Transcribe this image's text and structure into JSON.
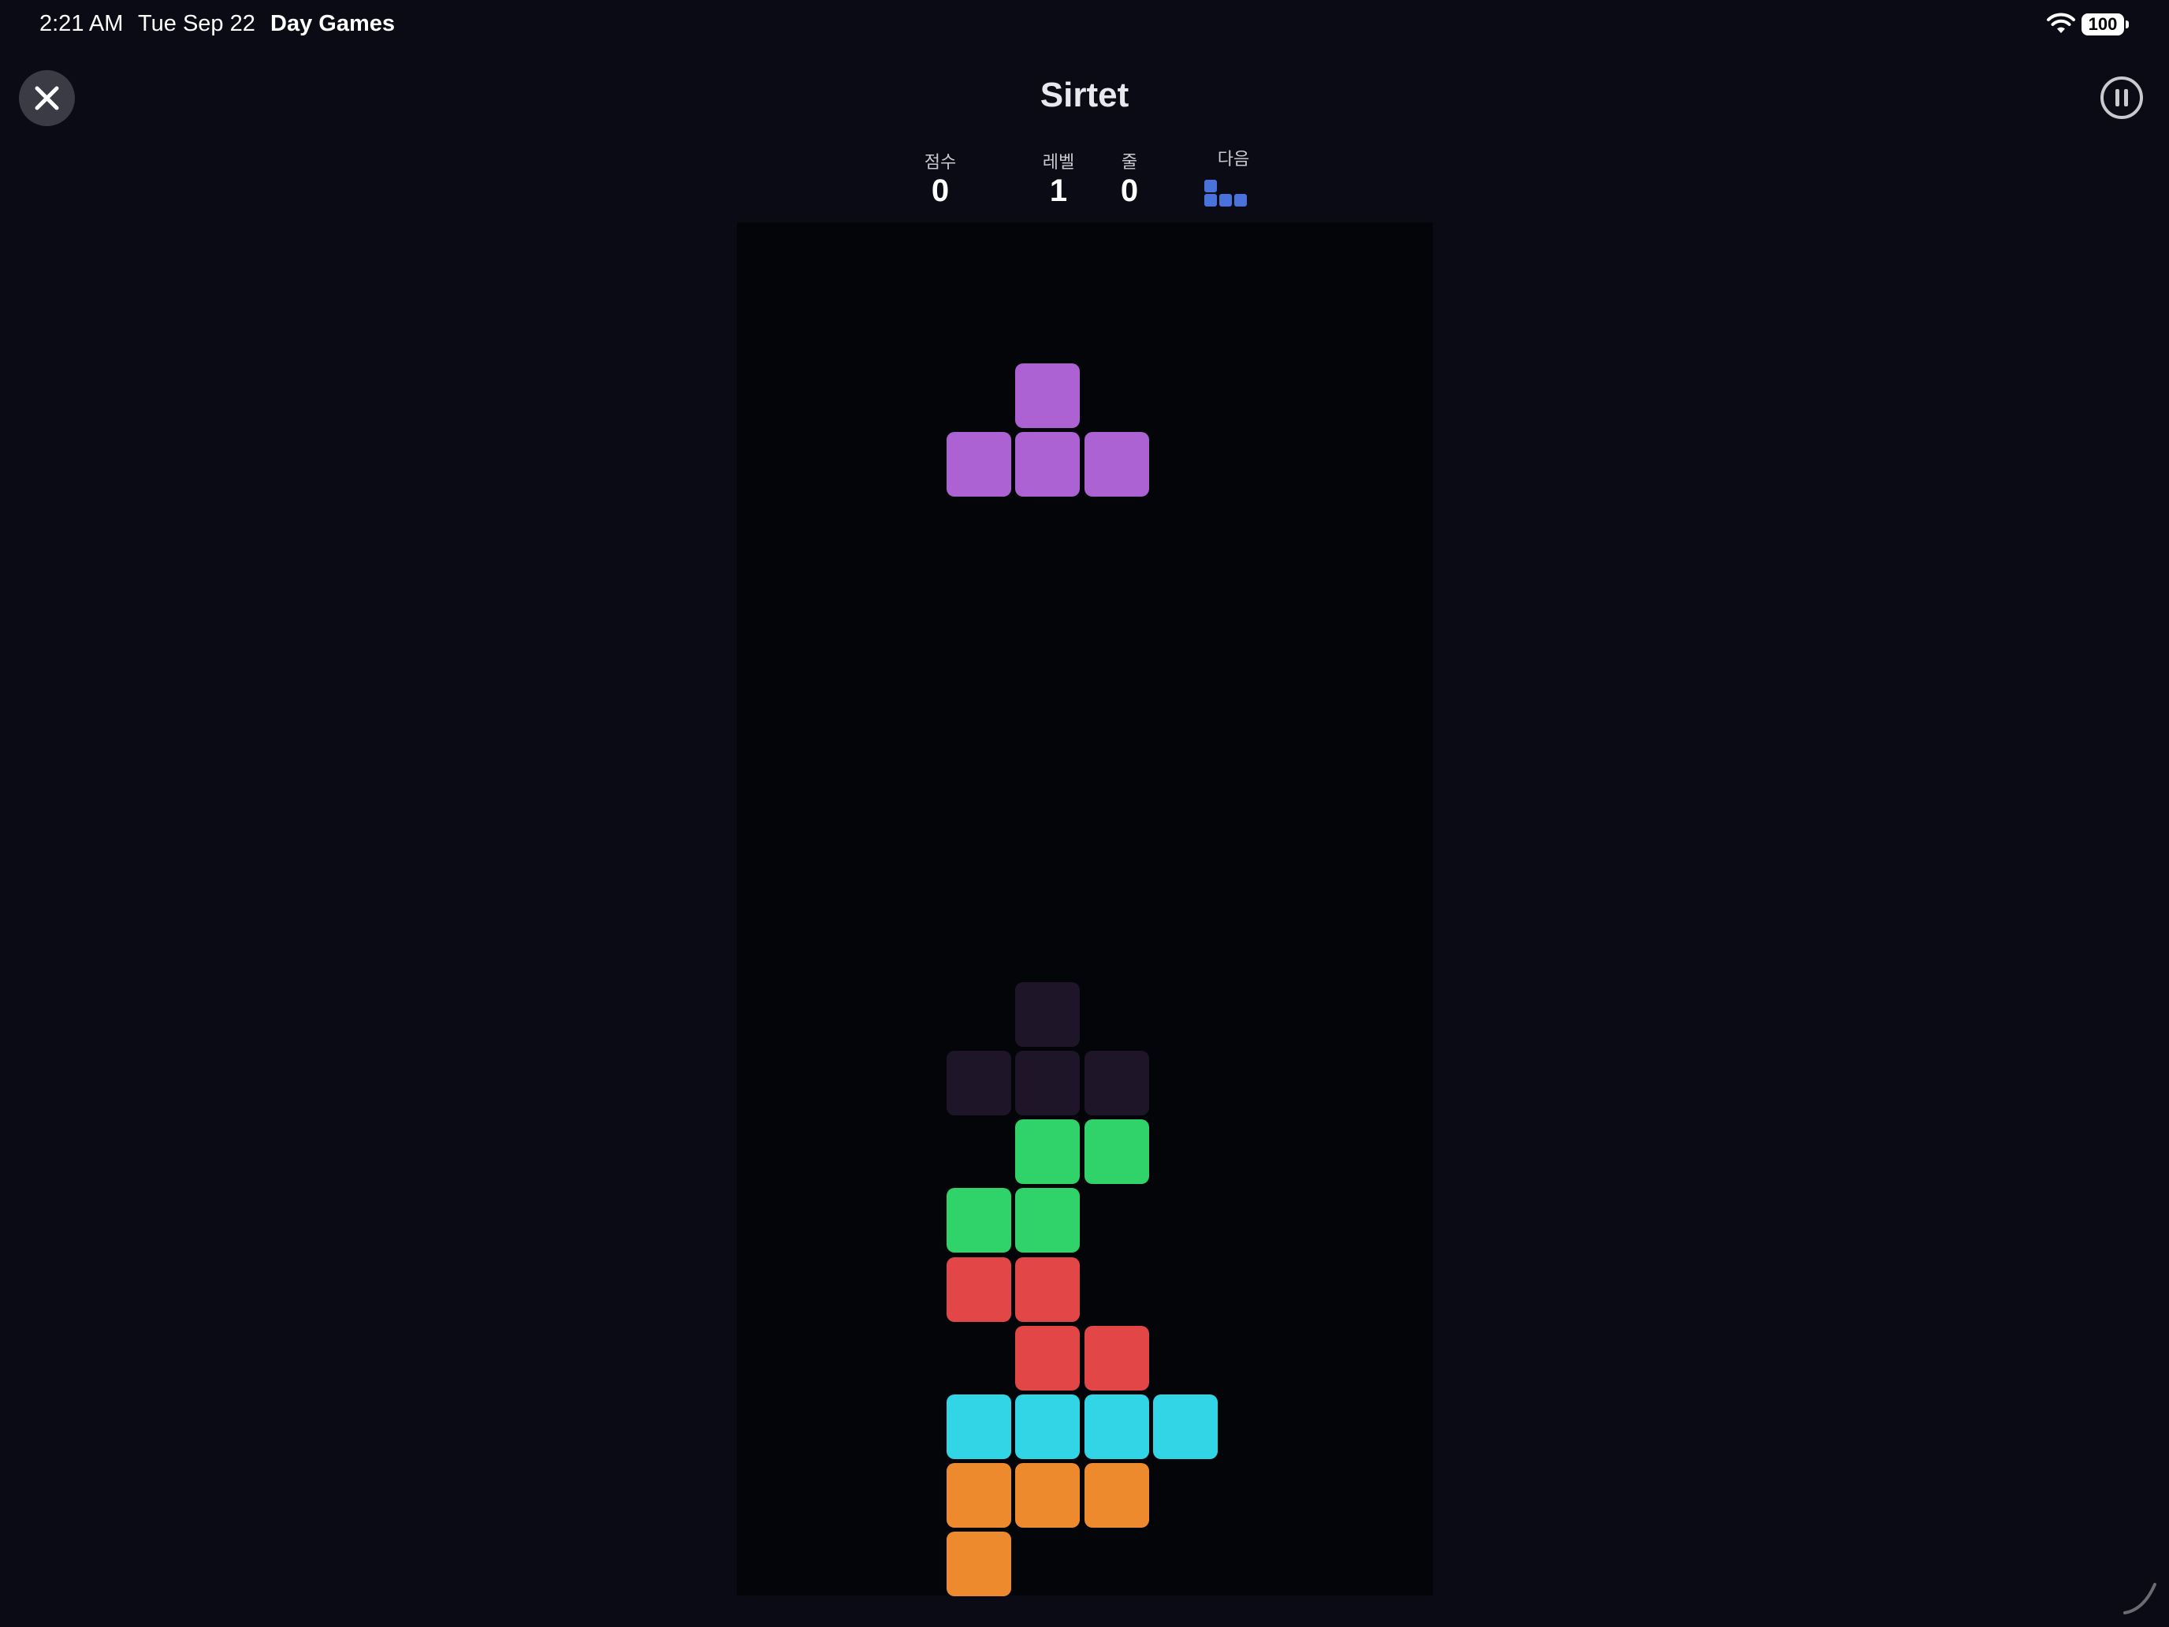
{
  "status_bar": {
    "time": "2:21 AM",
    "date": "Tue Sep 22",
    "app": "Day Games",
    "battery": "100"
  },
  "header": {
    "title": "Sirtet"
  },
  "stats": {
    "score_label": "점수",
    "score_value": "0",
    "level_label": "레벨",
    "level_value": "1",
    "lines_label": "줄",
    "lines_value": "0",
    "next_label": "다음"
  },
  "colors": {
    "background": "#0a0b14",
    "board": "#040508",
    "T": "#ad62d3",
    "ghost": "#1f1529",
    "S": "#2fd36a",
    "Z": "#e24646",
    "I": "#32d5e6",
    "L": "#ee8a2e",
    "next_piece": "#4a72db"
  },
  "board": {
    "columns": 10,
    "rows": 20,
    "active_piece": {
      "type": "T",
      "cells": [
        [
          4,
          2
        ],
        [
          3,
          3
        ],
        [
          4,
          3
        ],
        [
          5,
          3
        ]
      ]
    },
    "ghost_piece": {
      "type": "ghost",
      "cells": [
        [
          4,
          11
        ],
        [
          3,
          12
        ],
        [
          4,
          12
        ],
        [
          5,
          12
        ]
      ]
    },
    "locked_cells": [
      {
        "col": 4,
        "row": 13,
        "type": "S"
      },
      {
        "col": 5,
        "row": 13,
        "type": "S"
      },
      {
        "col": 3,
        "row": 14,
        "type": "S"
      },
      {
        "col": 4,
        "row": 14,
        "type": "S"
      },
      {
        "col": 3,
        "row": 15,
        "type": "Z"
      },
      {
        "col": 4,
        "row": 15,
        "type": "Z"
      },
      {
        "col": 4,
        "row": 16,
        "type": "Z"
      },
      {
        "col": 5,
        "row": 16,
        "type": "Z"
      },
      {
        "col": 3,
        "row": 17,
        "type": "I"
      },
      {
        "col": 4,
        "row": 17,
        "type": "I"
      },
      {
        "col": 5,
        "row": 17,
        "type": "I"
      },
      {
        "col": 6,
        "row": 17,
        "type": "I"
      },
      {
        "col": 3,
        "row": 18,
        "type": "L"
      },
      {
        "col": 4,
        "row": 18,
        "type": "L"
      },
      {
        "col": 5,
        "row": 18,
        "type": "L"
      },
      {
        "col": 3,
        "row": 19,
        "type": "L"
      }
    ]
  },
  "next_piece": {
    "type": "J",
    "cells": [
      [
        0,
        0
      ],
      [
        0,
        1
      ],
      [
        1,
        1
      ],
      [
        2,
        1
      ]
    ]
  },
  "icons": {
    "close": "close-icon",
    "pause": "pause-icon",
    "wifi": "wifi-icon",
    "battery": "battery-icon"
  }
}
